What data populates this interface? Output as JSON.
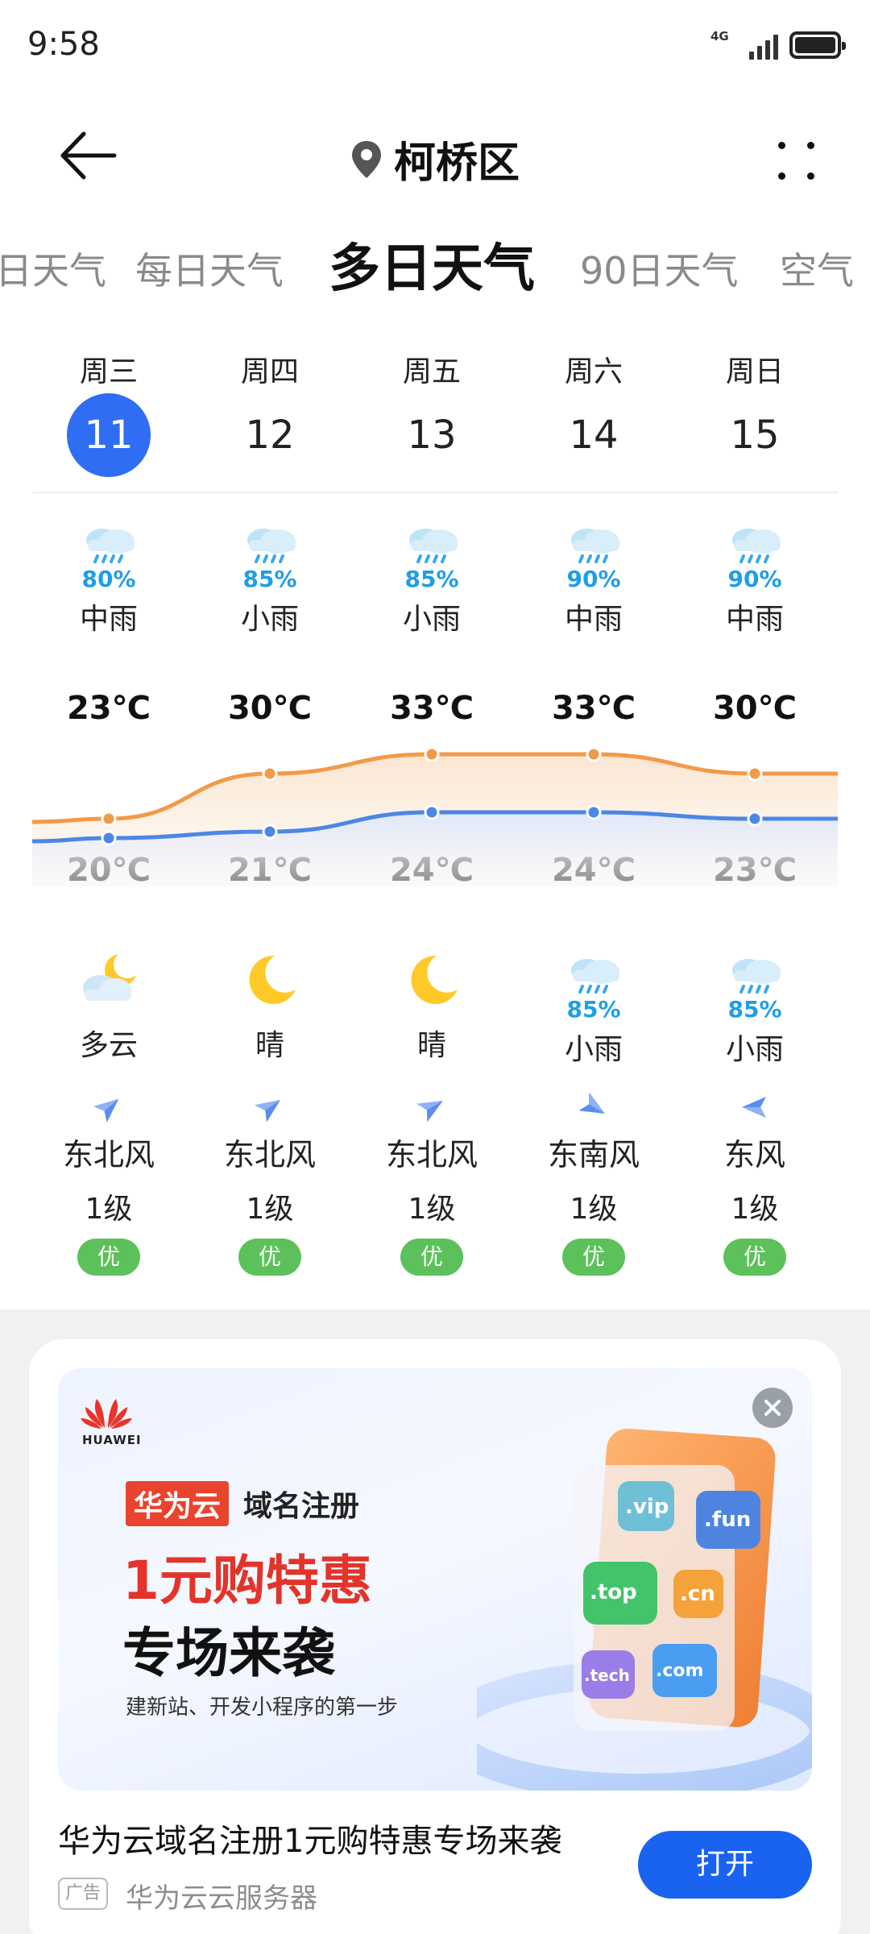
{
  "status_bar": {
    "time": "9:58",
    "network": "4G"
  },
  "header": {
    "location": "柯桥区"
  },
  "tabs": [
    "日天气",
    "每日天气",
    "多日天气",
    "90日天气",
    "空气"
  ],
  "days": [
    {
      "weekday": "周三",
      "date": "11",
      "day_prob": "80%",
      "day_cond": "中雨",
      "high": "23℃",
      "low": "20℃",
      "night_prob": "",
      "night_cond": "多云",
      "wind": "东北风",
      "level": "1级",
      "aqi": "优"
    },
    {
      "weekday": "周四",
      "date": "12",
      "day_prob": "85%",
      "day_cond": "小雨",
      "high": "30℃",
      "low": "21℃",
      "night_prob": "",
      "night_cond": "晴",
      "wind": "东北风",
      "level": "1级",
      "aqi": "优"
    },
    {
      "weekday": "周五",
      "date": "13",
      "day_prob": "85%",
      "day_cond": "小雨",
      "high": "33℃",
      "low": "24℃",
      "night_prob": "",
      "night_cond": "晴",
      "wind": "东北风",
      "level": "1级",
      "aqi": "优"
    },
    {
      "weekday": "周六",
      "date": "14",
      "day_prob": "90%",
      "day_cond": "中雨",
      "high": "33℃",
      "low": "24℃",
      "night_prob": "85%",
      "night_cond": "小雨",
      "wind": "东南风",
      "level": "1级",
      "aqi": "优"
    },
    {
      "weekday": "周日",
      "date": "15",
      "day_prob": "90%",
      "day_cond": "中雨",
      "high": "30℃",
      "low": "23℃",
      "night_prob": "85%",
      "night_cond": "小雨",
      "wind": "东风",
      "level": "1级",
      "aqi": "优"
    }
  ],
  "selected_day_index": 0,
  "chart_data": {
    "type": "line",
    "categories": [
      "周三",
      "周四",
      "周五",
      "周六",
      "周日"
    ],
    "series": [
      {
        "values": [
          23,
          30,
          33,
          33,
          30
        ],
        "color": "#f39a48"
      },
      {
        "values": [
          20,
          21,
          24,
          24,
          23
        ],
        "color": "#4c86e6"
      }
    ]
  },
  "ad": {
    "logo_text": "HUAWEI",
    "brand_tag": "华为云",
    "brand_sub": "域名注册",
    "promo_line1": "1元购特惠",
    "promo_line2": "专场来袭",
    "promo_line3": "建新站、开发小程序的第一步",
    "domains": [
      ".vip",
      ".fun",
      ".top",
      ".cn",
      ".tech",
      ".com"
    ],
    "title": "华为云域名注册1元购特惠专场来袭",
    "tag": "广告",
    "source": "华为云云服务器",
    "open_label": "打开"
  },
  "colors": {
    "accent": "#2f6ef2",
    "high_line": "#f39a48",
    "low_line": "#4c86e6",
    "aqi_good": "#5cc15a",
    "open_button": "#1a63f0"
  }
}
